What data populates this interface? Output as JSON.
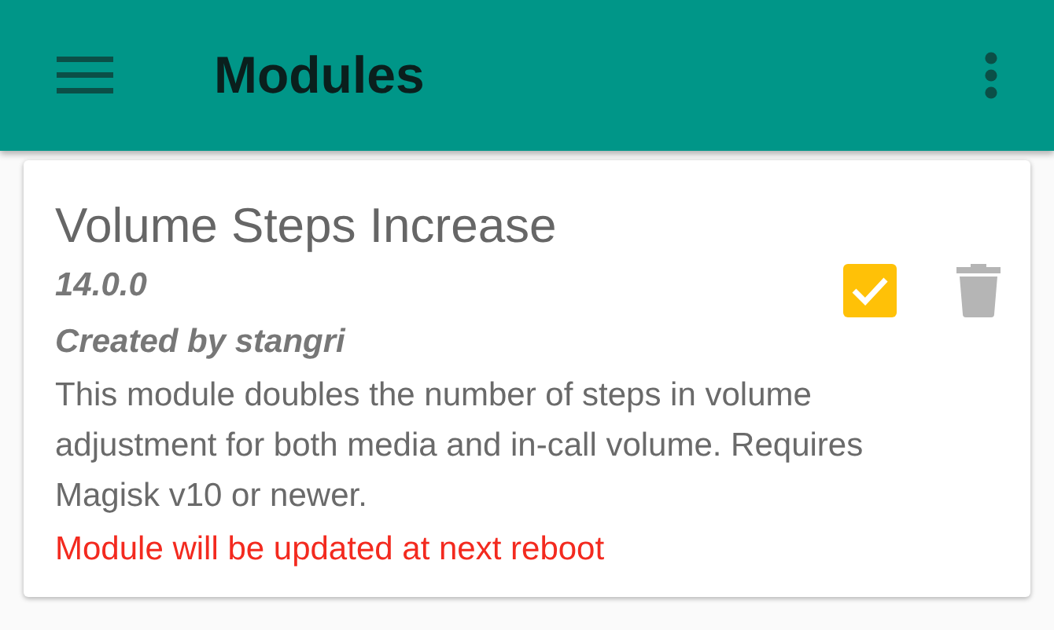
{
  "app_bar": {
    "title": "Modules"
  },
  "modules": [
    {
      "name": "Volume Steps Increase",
      "version": "14.0.0",
      "author": "Created by stangri",
      "description": "This module doubles the number of steps in volume adjustment for both media and in-call volume. Requires Magisk v10 or newer.",
      "notice": "Module will be updated at next reboot",
      "enabled": true
    }
  ]
}
